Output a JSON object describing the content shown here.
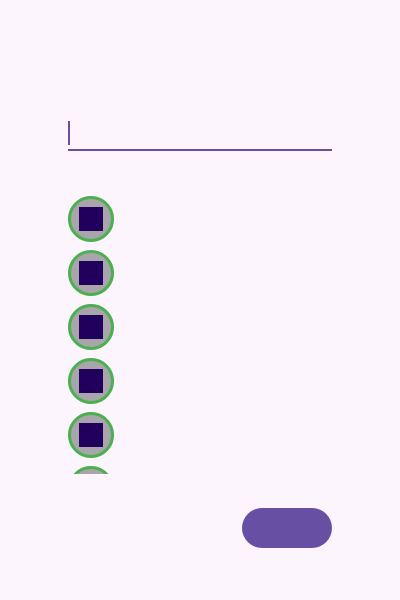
{
  "header": {
    "title": ""
  },
  "form": {
    "field_label": "",
    "field_value": "",
    "field_placeholder": ""
  },
  "list": {
    "section_label": "",
    "items": [
      {
        "label": "",
        "avatar_icon": "avatar-icon"
      },
      {
        "label": "",
        "avatar_icon": "avatar-icon"
      },
      {
        "label": "",
        "avatar_icon": "avatar-icon"
      },
      {
        "label": "",
        "avatar_icon": "avatar-icon"
      },
      {
        "label": "",
        "avatar_icon": "avatar-icon"
      },
      {
        "label": "",
        "avatar_icon": "avatar-icon"
      }
    ]
  },
  "actions": {
    "cancel_label": "",
    "confirm_label": ""
  },
  "colors": {
    "background": "#fcf5fd",
    "primary": "#6750a4",
    "danger": "#b3261e",
    "avatar_ring": "#4caf50",
    "avatar_fill": "#a8a6ab",
    "avatar_icon": "#21005d",
    "text": "#1c1b1f"
  }
}
